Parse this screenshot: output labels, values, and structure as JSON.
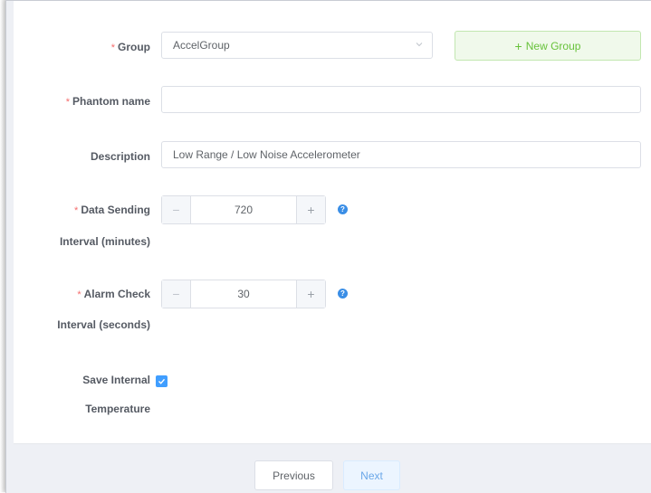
{
  "form": {
    "group": {
      "label": "Group",
      "value": "AccelGroup",
      "new_group_label": "New Group"
    },
    "phantom_name": {
      "label": "Phantom name",
      "value": ""
    },
    "description": {
      "label": "Description",
      "value": "Low Range / Low Noise Accelerometer"
    },
    "data_sending": {
      "label_line1": "Data Sending",
      "label_line2": "Interval (minutes)",
      "value": "720"
    },
    "alarm_check": {
      "label_line1": "Alarm Check",
      "label_line2": "Interval (seconds)",
      "value": "30"
    },
    "save_temp": {
      "label_line1": "Save Internal",
      "label_line2": "Temperature",
      "checked": true
    },
    "required_mark": "*"
  },
  "footer": {
    "previous_label": "Previous",
    "next_label": "Next"
  },
  "icons": {
    "plus": "+",
    "minus": "−",
    "help": "?"
  },
  "colors": {
    "accent": "#409eff",
    "success": "#67c23a",
    "required": "#f56c6c"
  }
}
